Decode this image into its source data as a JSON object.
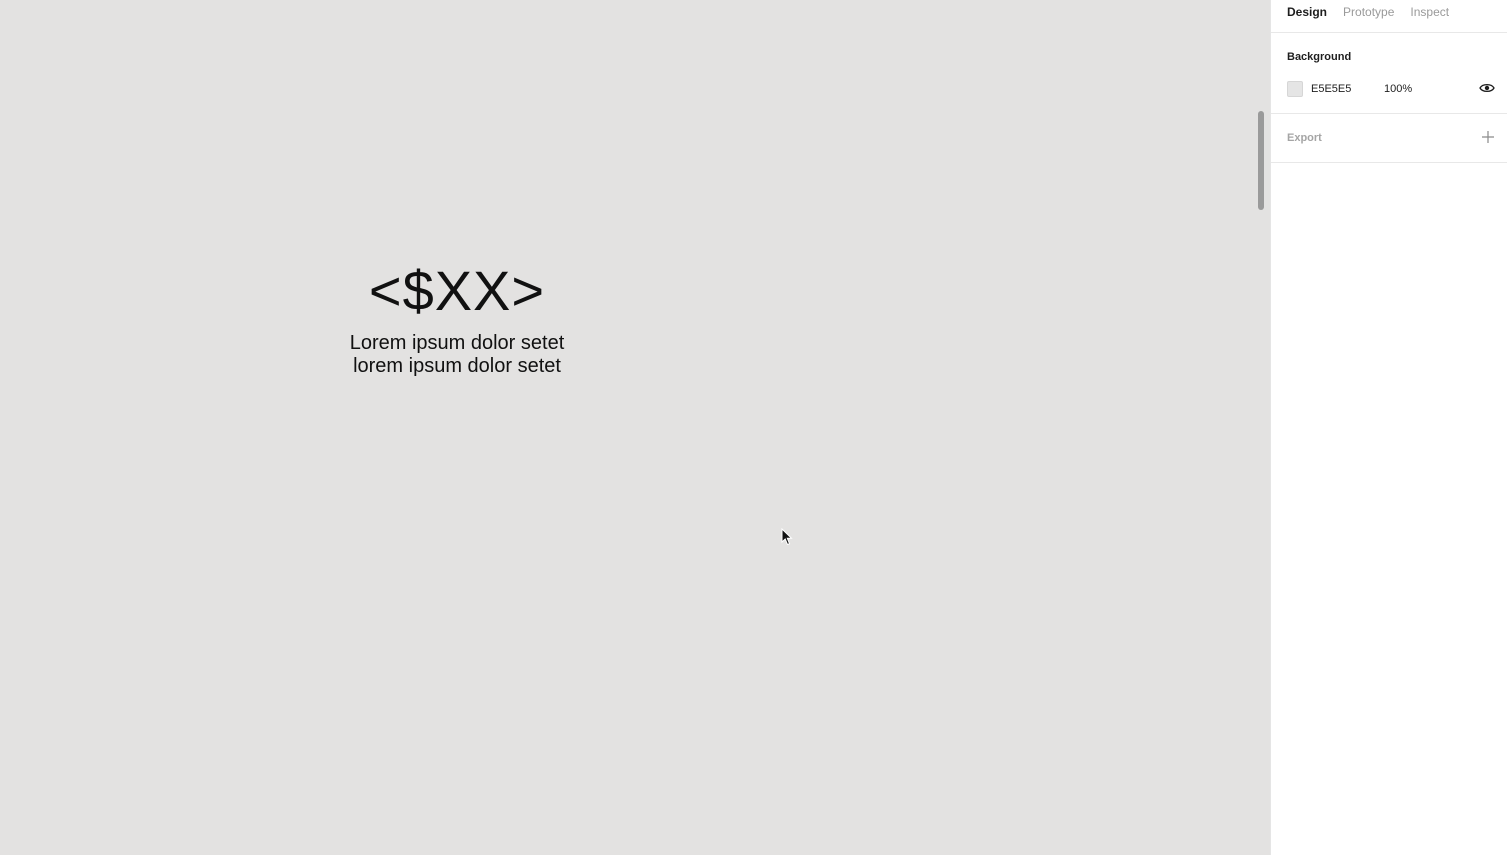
{
  "canvas": {
    "background": "#E3E2E1",
    "price_text": "<$XX>",
    "description_lines": [
      "Lorem ipsum dolor setet",
      "lorem ipsum dolor setet"
    ]
  },
  "panel": {
    "tabs": [
      {
        "label": "Design",
        "active": true
      },
      {
        "label": "Prototype",
        "active": false
      },
      {
        "label": "Inspect",
        "active": false
      }
    ],
    "background": {
      "title": "Background",
      "hex": "E5E5E5",
      "opacity": "100%",
      "swatch_color": "#E5E5E5",
      "visibility_icon": "eye-icon"
    },
    "export": {
      "title": "Export",
      "add_icon": "plus-icon"
    }
  }
}
